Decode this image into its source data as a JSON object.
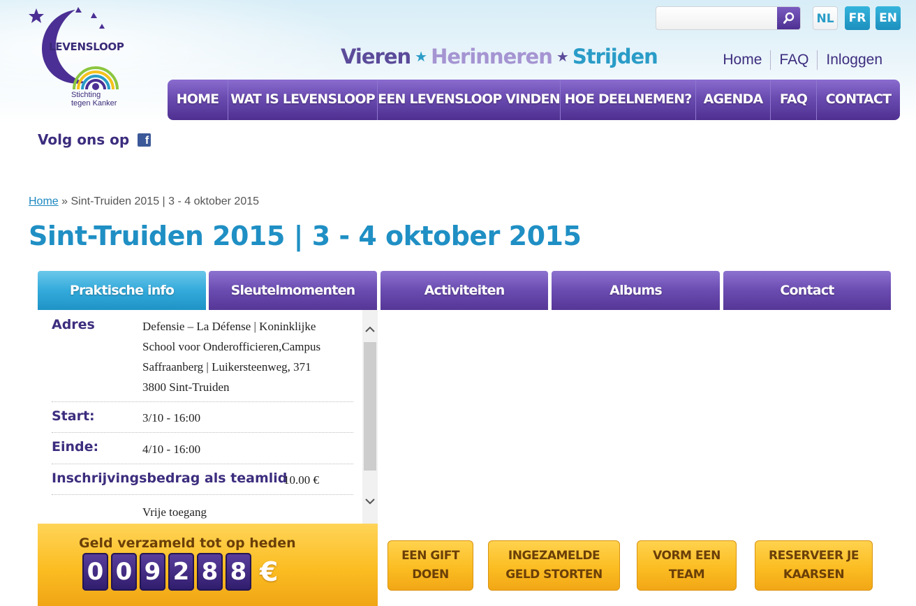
{
  "brand": {
    "logo_word": "LEVENSLOOP",
    "logo_sub_line1": "Stichting",
    "logo_sub_line2": "tegen Kanker",
    "tagline": [
      "Vieren",
      "Herinneren",
      "Strijden"
    ]
  },
  "colors": {
    "purple": "#5a3c9f",
    "blue": "#1f8fc4",
    "gold": "#fbbd22",
    "dark_text": "#3d2d7e"
  },
  "search": {
    "placeholder": "",
    "icon": "search-icon"
  },
  "languages": [
    "NL",
    "FR",
    "EN"
  ],
  "top_links": [
    "Home",
    "FAQ",
    "Inloggen"
  ],
  "main_nav": [
    "HOME",
    "WAT IS LEVENSLOOP",
    "EEN LEVENSLOOP VINDEN",
    "HOE DEELNEMEN?",
    "AGENDA",
    "FAQ",
    "CONTACT"
  ],
  "social": {
    "label": "Volg ons op",
    "icon": "facebook-icon",
    "glyph": "f"
  },
  "breadcrumb": {
    "home": "Home",
    "separator": "»",
    "current": "Sint-Truiden 2015 | 3 - 4 oktober 2015"
  },
  "page_title": "Sint-Truiden 2015 | 3 - 4 oktober 2015",
  "tabs": [
    "Praktische info",
    "Sleutelmomenten",
    "Activiteiten",
    "Albums",
    "Contact"
  ],
  "info": {
    "address_label": "Adres",
    "address_lines": [
      "Defensie – La Défense | Koninklijke",
      "School voor Onderofficieren,Campus",
      "Saffraanberg | Luikersteenweg, 371",
      "3800 Sint-Truiden"
    ],
    "start_label": "Start:",
    "start_value": "3/10 - 16:00",
    "end_label": "Einde:",
    "end_value": "4/10 - 16:00",
    "fee_label": "Inschrijvingsbedrag als teamlid",
    "fee_value": "10.00 €",
    "extra_value": "Vrije toegang"
  },
  "funds": {
    "label": "Geld verzameld tot op heden",
    "digits": [
      "0",
      "0",
      "9",
      "2",
      "8",
      "8"
    ],
    "currency": "€"
  },
  "actions": [
    {
      "line1": "EEN GIFT",
      "line2": "DOEN"
    },
    {
      "line1": "INGEZAMELDE",
      "line2": "GELD STORTEN"
    },
    {
      "line1": "VORM EEN",
      "line2": "TEAM"
    },
    {
      "line1": "RESERVEER JE",
      "line2": "KAARSEN"
    }
  ]
}
